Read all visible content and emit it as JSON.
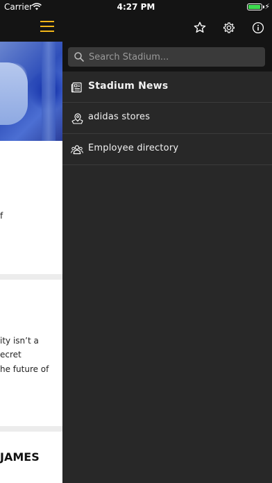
{
  "status_bar": {
    "carrier": "Carrier",
    "time": "4:27 PM",
    "battery_level": 0.95
  },
  "background_content": {
    "fragments": [
      "f",
      "ity isn’t a",
      "ecret",
      "he future of",
      "JAMES"
    ]
  },
  "drawer": {
    "header_icons": [
      "star-icon",
      "gear-icon",
      "info-icon"
    ],
    "search": {
      "placeholder": "Search Stadium..."
    },
    "items": [
      {
        "label": "Stadium News",
        "icon": "newspaper-icon",
        "active": true
      },
      {
        "label": "adidas stores",
        "icon": "map-pin-icon",
        "active": false
      },
      {
        "label": "Employee directory",
        "icon": "people-icon",
        "active": false
      }
    ]
  },
  "colors": {
    "accent": "#f2b619",
    "drawer_bg": "#282828",
    "header_bg": "#141414"
  }
}
